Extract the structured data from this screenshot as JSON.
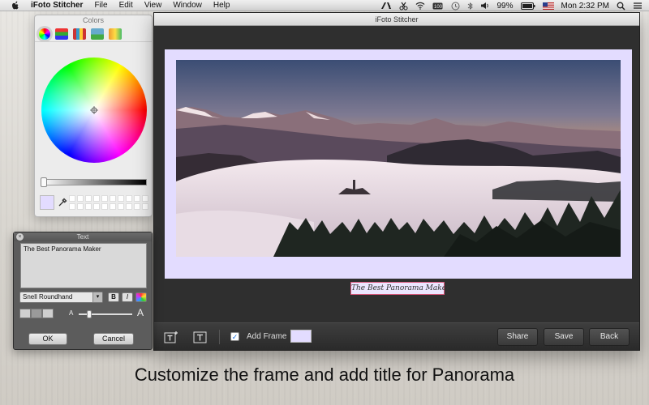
{
  "menubar": {
    "app_name": "iFoto Stitcher",
    "menus": [
      "File",
      "Edit",
      "View",
      "Window",
      "Help"
    ],
    "battery_text": "99%",
    "clock": "Mon 2:32 PM",
    "icons": [
      "apple-icon",
      "adobe-icon",
      "scissors-icon",
      "wifi-icon",
      "bluetooth-icon",
      "time-machine-icon",
      "battery-icon",
      "flag-icon",
      "search-icon",
      "list-icon"
    ]
  },
  "colors_panel": {
    "title": "Colors",
    "tabs": [
      "color-wheel-tab",
      "sliders-tab",
      "palettes-tab",
      "image-palettes-tab",
      "pencils-tab"
    ],
    "selected_color": "#e3dcff"
  },
  "window": {
    "title": "iFoto Stitcher",
    "frame_color": "#e3dcff",
    "photo_title": "The Best Panorama Maker",
    "add_frame_label": "Add Frame",
    "add_frame_checked": true,
    "share_label": "Share",
    "save_label": "Save",
    "back_label": "Back"
  },
  "text_panel": {
    "title": "Text",
    "text_value": "The Best Panorama Maker",
    "font_name": "Snell Roundhand",
    "bold_label": "B",
    "italic_label": "I",
    "small_a": "A",
    "big_a": "A",
    "ok_label": "OK",
    "cancel_label": "Cancel"
  },
  "promo_text": "Customize the frame and add title for Panorama"
}
